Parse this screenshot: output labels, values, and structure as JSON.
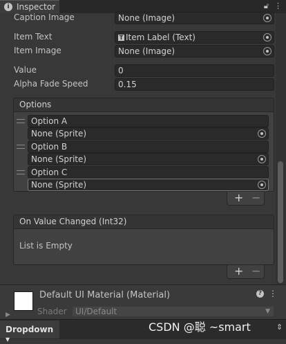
{
  "window": {
    "tab_title": "Inspector",
    "tab_icon": "info-icon",
    "lock_icon": "lock-icon",
    "menu_icon": "kebab-menu-icon"
  },
  "fields": [
    {
      "label": "Caption Image",
      "value": "None (Image)",
      "picker": true
    },
    {
      "label": "Item Text",
      "value": "Item Label (Text)",
      "picker": true,
      "value_icon": "text-component-icon"
    },
    {
      "label": "Item Image",
      "value": "None (Image)",
      "picker": true
    },
    {
      "label": "Value",
      "value": "0",
      "picker": false
    },
    {
      "label": "Alpha Fade Speed",
      "value": "0.15",
      "picker": false
    }
  ],
  "options_list": {
    "title": "Options",
    "items": [
      {
        "text": "Option A",
        "sprite": "None (Sprite)"
      },
      {
        "text": "Option B",
        "sprite": "None (Sprite)"
      },
      {
        "text": "Option C",
        "sprite": "None (Sprite)"
      }
    ],
    "add_label": "+",
    "remove_label": "−"
  },
  "event": {
    "title": "On Value Changed (Int32)",
    "empty_text": "List is Empty",
    "add_label": "+",
    "remove_label": "−"
  },
  "material": {
    "name": "Default UI Material (Material)",
    "shader_label": "Shader",
    "shader_value": "UI/Default",
    "swatch_color": "#ffffff"
  },
  "bottom": {
    "object_dropdown": "Dropdown ▾",
    "watermark": "CSDN @聪        ~smart"
  },
  "colors": {
    "background": "#383838",
    "field_bg": "#2a2a2a",
    "text": "#c4c4c4"
  }
}
